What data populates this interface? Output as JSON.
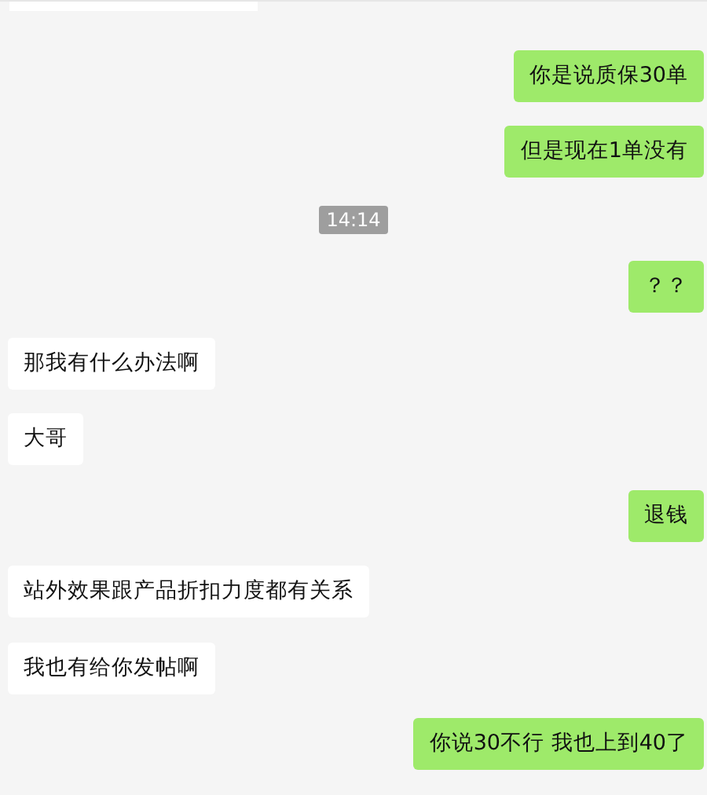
{
  "messages": [
    {
      "kind": "sent",
      "text": "你是说质保30单"
    },
    {
      "kind": "sent",
      "text": "但是现在1单没有"
    },
    {
      "kind": "time",
      "text": "14:14"
    },
    {
      "kind": "sent",
      "text": "？？"
    },
    {
      "kind": "received",
      "text": "那我有什么办法啊"
    },
    {
      "kind": "received",
      "text": "大哥"
    },
    {
      "kind": "sent",
      "text": "退钱"
    },
    {
      "kind": "received",
      "text": "站外效果跟产品折扣力度都有关系"
    },
    {
      "kind": "received",
      "text": "我也有给你发帖啊"
    },
    {
      "kind": "sent",
      "text": "你说30不行 我也上到40了"
    }
  ]
}
